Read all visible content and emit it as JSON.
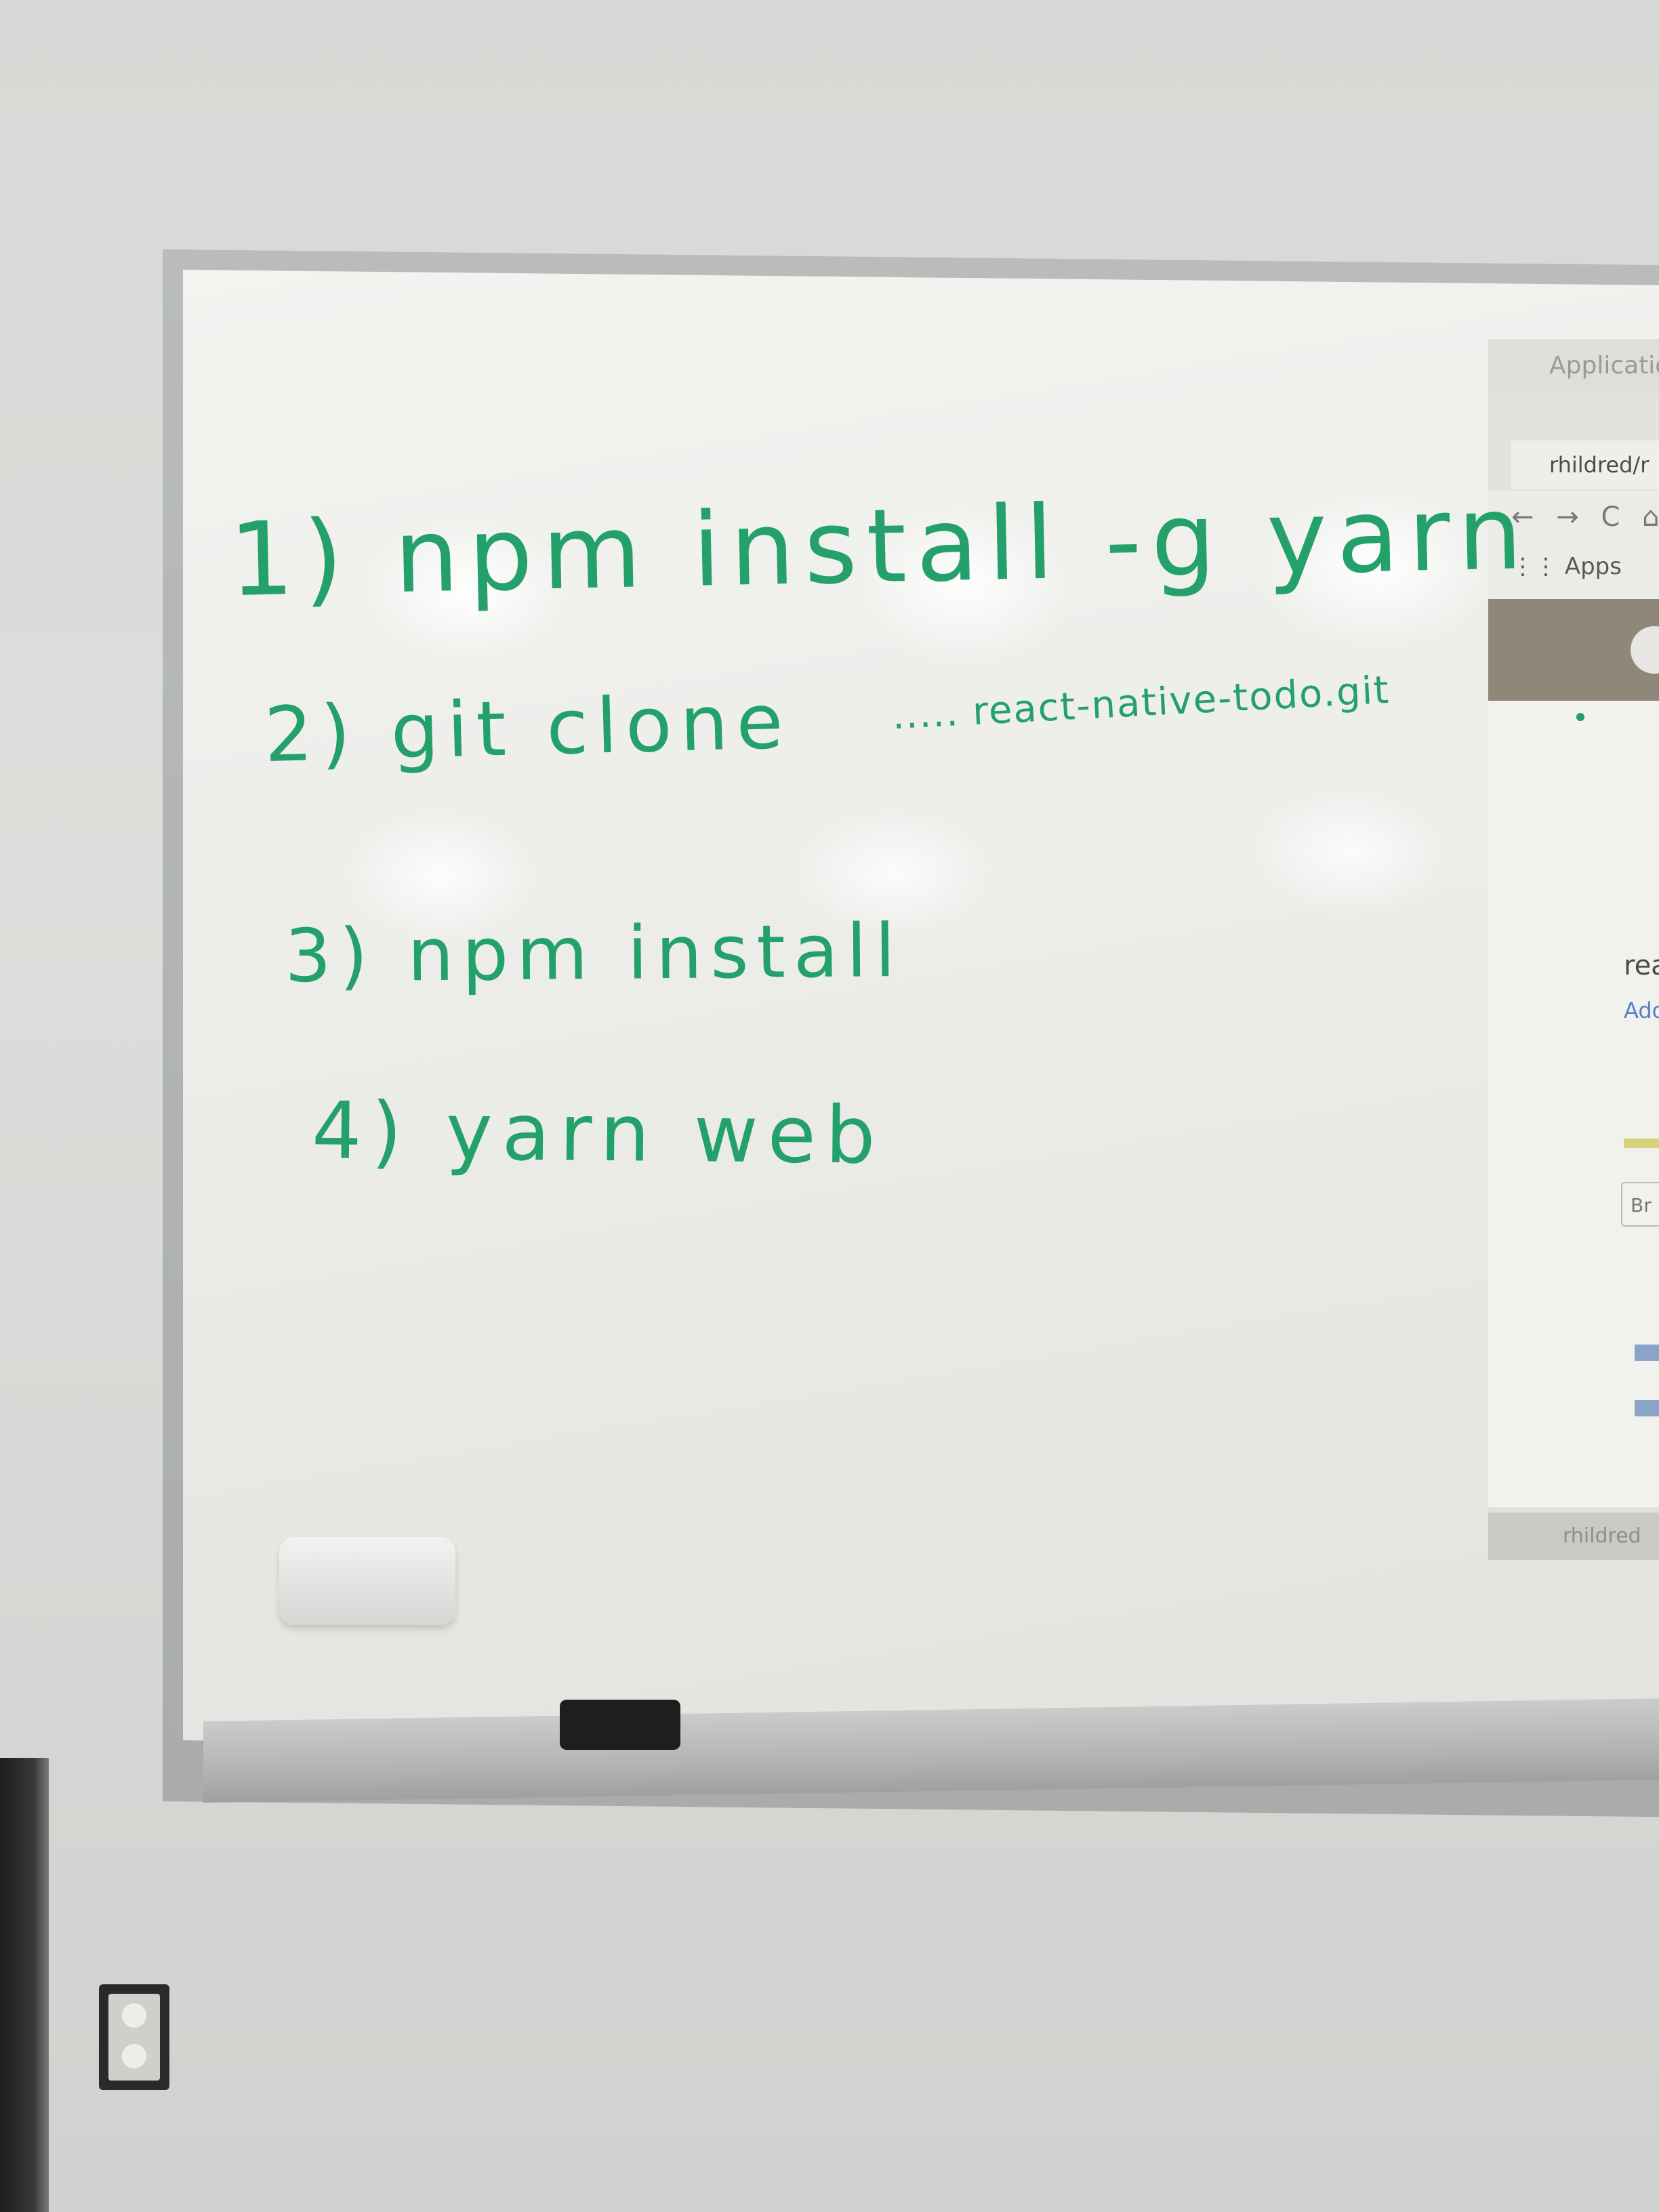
{
  "whiteboard": {
    "lines": [
      "1) npm install -g yarn",
      "2) git clone",
      "3) npm install",
      "4) yarn web"
    ],
    "clone_suffix": "..... react-native-todo.git",
    "ink_color": "#24a06a"
  },
  "projection": {
    "window_title": "Application",
    "tab_title": "rhildred/r",
    "nav_icons": "← → C ⌂",
    "bookmarks_label": "Apps",
    "repo_name_partial": "rea",
    "add_link_partial": "Add",
    "branch_button_partial": "Br",
    "taskbar_item": "rhildred"
  }
}
